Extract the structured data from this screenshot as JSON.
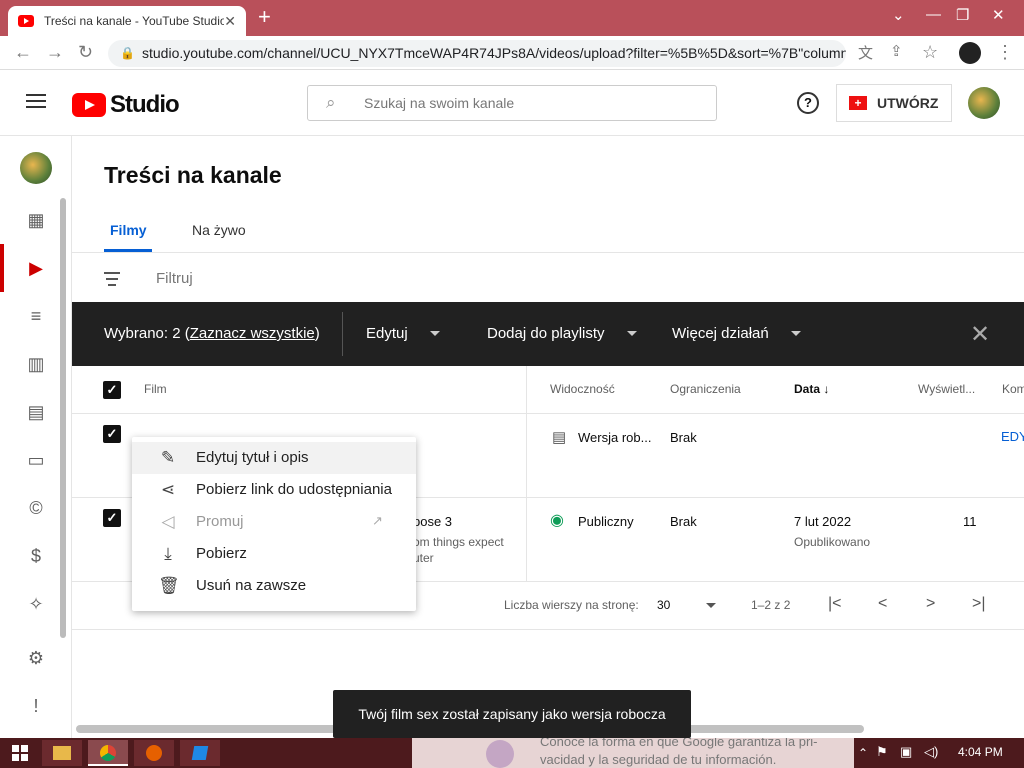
{
  "browser": {
    "tab_title": "Treści na kanale - YouTube Studio",
    "url": "studio.youtube.com/channel/UCU_NYX7TmceWAP4R74JPs8A/videos/upload?filter=%5B%5D&sort=%7B\"column...",
    "new_tab": "+",
    "close": "✕"
  },
  "header": {
    "logo_text": "Studio",
    "search_placeholder": "Szukaj na swoim kanale",
    "help": "?",
    "create_label": "UTWÓRZ"
  },
  "page": {
    "title": "Treści na kanale",
    "tabs": [
      "Filmy",
      "Na żywo"
    ],
    "filter_placeholder": "Filtruj"
  },
  "actionbar": {
    "selected_prefix": "Wybrano: 2 (",
    "select_all": "Zaznacz wszystkie",
    "selected_suffix": ")",
    "edit": "Edytuj",
    "add_playlist": "Dodaj do playlisty",
    "more": "Więcej działań"
  },
  "table": {
    "headers": {
      "film": "Film",
      "visibility": "Widoczność",
      "restrictions": "Ograniczenia",
      "date": "Data",
      "views": "Wyświetl...",
      "comments": "Kom"
    },
    "rows": [
      {
        "visibility": "Wersja rob...",
        "restrictions": "Brak",
        "action": "EDY"
      },
      {
        "title_fragment": "pose 3",
        "desc_line1": "om things expect",
        "desc_line2": "uter",
        "visibility": "Publiczny",
        "restrictions": "Brak",
        "date": "7 lut 2022",
        "date_status": "Opublikowano",
        "views": "11"
      }
    ],
    "footer": {
      "rows_per_page_label": "Liczba wierszy na stronę:",
      "rows_per_page": "30",
      "range": "1–2 z 2"
    }
  },
  "context_menu": {
    "items": [
      {
        "label": "Edytuj tytuł i opis",
        "icon": "pencil-icon"
      },
      {
        "label": "Pobierz link do udostępniania",
        "icon": "share-icon"
      },
      {
        "label": "Promuj",
        "icon": "megaphone-icon",
        "disabled": true
      },
      {
        "label": "Pobierz",
        "icon": "download-icon"
      },
      {
        "label": "Usuń na zawsze",
        "icon": "trash-icon"
      }
    ]
  },
  "snackbar": "Twój film sex został zapisany jako wersja robocza",
  "taskbar": {
    "ad_line1": "Conoce la forma en que Google garantiza la pri-",
    "ad_line2": "vacidad y la seguridad de tu información.",
    "time": "4:04 PM"
  },
  "colors": {
    "accent_blue": "#065fd4",
    "brand_red": "#ff0000",
    "visibility_green": "#0f9d58"
  }
}
